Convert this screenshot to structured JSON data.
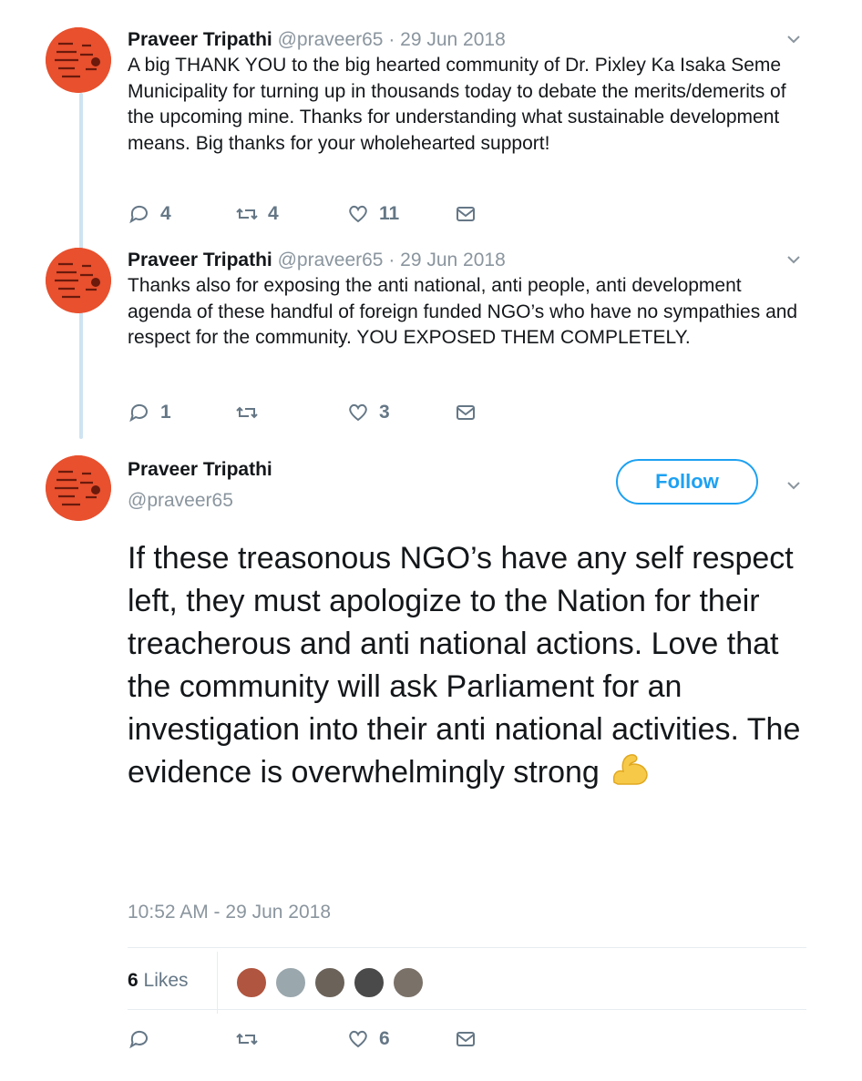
{
  "tweets": [
    {
      "name": "Praveer Tripathi",
      "handle": "@praveer65",
      "sep": "·",
      "date": "29 Jun 2018",
      "text": "A big THANK YOU to the big hearted community of Dr. Pixley Ka Isaka Seme Municipality for turning up in thousands today to debate the merits/demerits of the upcoming mine. Thanks for understanding what sustainable development means. Big thanks for your wholehearted support!",
      "replies": "4",
      "retweets": "4",
      "likes": "11"
    },
    {
      "name": "Praveer Tripathi",
      "handle": "@praveer65",
      "sep": "·",
      "date": "29 Jun 2018",
      "text": "Thanks also for exposing the anti national, anti people, anti development agenda of these handful of foreign funded NGO’s who have no sympathies and respect for the community. YOU EXPOSED THEM COMPLETELY.",
      "replies": "1",
      "retweets": "",
      "likes": "3"
    }
  ],
  "main": {
    "name": "Praveer Tripathi",
    "handle": "@praveer65",
    "follow_label": "Follow",
    "text": "If these treasonous NGO’s have any self respect left, they must apologize to the Nation for their treacherous and anti national actions. Love that the community will ask Parliament for an investigation into their anti national activities. The evidence is overwhelmingly strong",
    "emoji": "flexed-biceps-icon",
    "timestamp": "10:52 AM - 29 Jun 2018",
    "likes_count": "6",
    "likes_label": "Likes",
    "likes": "6",
    "liker_colors": [
      "#b0553f",
      "#9aa7ad",
      "#6b625a",
      "#4a4a4a",
      "#7a7169"
    ]
  },
  "colors": {
    "accent": "#1da1f2",
    "muted": "#8a959e",
    "avatar": "#e8502e",
    "thread_line": "#cfe3f1"
  }
}
